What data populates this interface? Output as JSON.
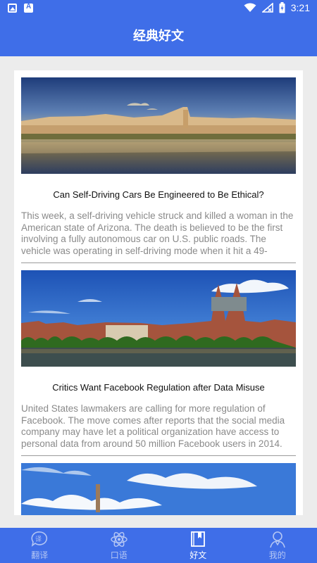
{
  "status_bar": {
    "time": "3:21",
    "left_icons": [
      "image-notification-icon",
      "font-notification-icon"
    ],
    "right_icons": [
      "wifi-icon",
      "no-signal-icon",
      "battery-charging-icon"
    ]
  },
  "header": {
    "title": "经典好文"
  },
  "articles": [
    {
      "image": "florence-river-photo",
      "title": "Can Self-Driving Cars Be Engineered to Be Ethical?",
      "summary": "This week, a self-driving vehicle struck and killed a woman in the American state of Arizona. The death is believed to be the first involving a fully autonomous car on U.S. public roads. The vehicle was operating in self-driving mode when it hit a 49-"
    },
    {
      "image": "bremen-waterfront-photo",
      "title": "Critics Want Facebook Regulation after Data Misuse",
      "summary": "United States lawmakers are calling for more regulation of Facebook. The move comes after reports that the social media company may have let a political organization have access to personal data from around 50 million Facebook users in 2014."
    },
    {
      "image": "sky-tower-photo",
      "title": "",
      "summary": ""
    }
  ],
  "bottom_nav": {
    "items": [
      {
        "label": "翻译",
        "icon": "translate-icon",
        "active": false
      },
      {
        "label": "口语",
        "icon": "atom-icon",
        "active": false
      },
      {
        "label": "好文",
        "icon": "book-icon",
        "active": true
      },
      {
        "label": "我的",
        "icon": "person-icon",
        "active": false
      }
    ]
  },
  "colors": {
    "primary": "#3f6ee8",
    "nav_inactive": "#b4c6f4",
    "summary_text": "#8a8a8a"
  }
}
